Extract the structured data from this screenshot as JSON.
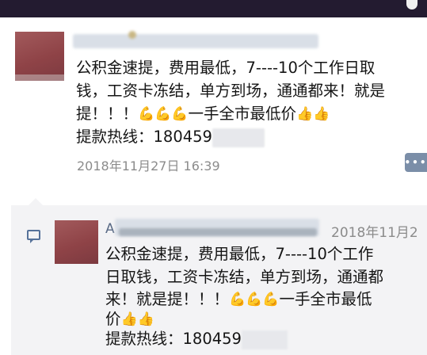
{
  "post": {
    "line1": "公积金速提，费用最低，7----10个工作日取",
    "line2": "钱，工资卡冻结，单方到场，通通都来！就是",
    "line3_text": "提！！！",
    "line3_tail": "一手全市最低价",
    "hotline_label": "提款热线：",
    "hotline_number": "180459",
    "timestamp": "2018年11月27日 16:39"
  },
  "comment": {
    "author_prefix": "A",
    "timestamp": "2018年11月2",
    "line1": "公积金速提，费用最低，7----10个工作",
    "line2": "日取钱，工资卡冻结，单方到场，通通都",
    "line3_text": "来！就是提！！！",
    "line3_tail": "一手全市最低",
    "line4": "价",
    "hotline_label": "提款热线：",
    "hotline_number": "180459"
  },
  "emoji": {
    "flex": "💪",
    "thumbs_up": "👍"
  },
  "icons": {
    "more": "ellipsis-icon",
    "comment": "comment-icon"
  },
  "colors": {
    "top_bar": "#231b30",
    "link_blue": "#56729a",
    "timestamp_gray": "#8b8b8b",
    "comment_panel": "#f3f3f5"
  }
}
